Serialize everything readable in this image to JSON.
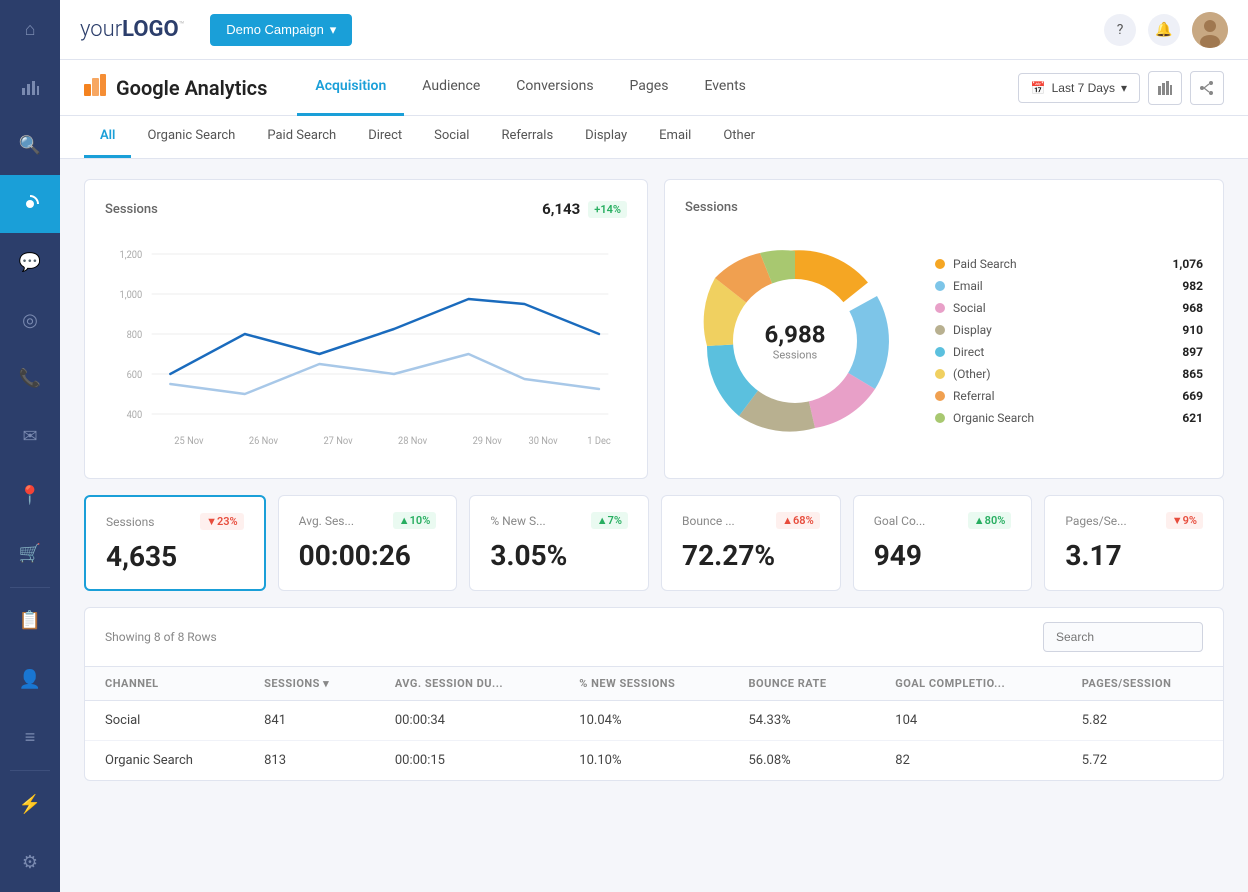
{
  "logo": {
    "text_your": "your",
    "text_logo": "LOGO",
    "trademark": "™"
  },
  "topbar": {
    "demo_btn": "Demo Campaign",
    "question_icon": "?",
    "bell_icon": "🔔"
  },
  "ga_header": {
    "title": "Google Analytics",
    "nav": [
      {
        "label": "Acquisition",
        "active": true
      },
      {
        "label": "Audience",
        "active": false
      },
      {
        "label": "Conversions",
        "active": false
      },
      {
        "label": "Pages",
        "active": false
      },
      {
        "label": "Events",
        "active": false
      }
    ],
    "date_btn": "Last 7 Days",
    "calendar_icon": "📅"
  },
  "sub_nav": {
    "items": [
      {
        "label": "All",
        "active": true
      },
      {
        "label": "Organic Search",
        "active": false
      },
      {
        "label": "Paid Search",
        "active": false
      },
      {
        "label": "Direct",
        "active": false
      },
      {
        "label": "Social",
        "active": false
      },
      {
        "label": "Referrals",
        "active": false
      },
      {
        "label": "Display",
        "active": false
      },
      {
        "label": "Email",
        "active": false
      },
      {
        "label": "Other",
        "active": false
      }
    ]
  },
  "sessions_chart": {
    "title": "Sessions",
    "value": "6,143",
    "badge": "+14%",
    "badge_type": "up",
    "x_labels": [
      "25 Nov",
      "26 Nov",
      "27 Nov",
      "28 Nov",
      "29 Nov",
      "30 Nov",
      "1 Dec"
    ],
    "y_labels": [
      "1,200",
      "1,000",
      "800",
      "600",
      "400"
    ]
  },
  "donut_chart": {
    "title": "Sessions",
    "center_value": "6,988",
    "center_label": "Sessions",
    "legend": [
      {
        "label": "Paid Search",
        "value": "1,076",
        "color": "#f5a623"
      },
      {
        "label": "Email",
        "value": "982",
        "color": "#7dc5e8"
      },
      {
        "label": "Social",
        "value": "968",
        "color": "#e8a0c8"
      },
      {
        "label": "Display",
        "value": "910",
        "color": "#b8b090"
      },
      {
        "label": "Direct",
        "value": "897",
        "color": "#5bc0de"
      },
      {
        "label": "(Other)",
        "value": "865",
        "color": "#f0d060"
      },
      {
        "label": "Referral",
        "value": "669",
        "color": "#f0a050"
      },
      {
        "label": "Organic Search",
        "value": "621",
        "color": "#a8c870"
      }
    ]
  },
  "metric_cards": [
    {
      "name": "Sessions",
      "value": "4,635",
      "badge": "▼23%",
      "badge_type": "down",
      "selected": true
    },
    {
      "name": "Avg. Ses...",
      "value": "00:00:26",
      "badge": "▲10%",
      "badge_type": "up",
      "selected": false
    },
    {
      "name": "% New S...",
      "value": "3.05%",
      "badge": "▲7%",
      "badge_type": "up",
      "selected": false
    },
    {
      "name": "Bounce ...",
      "value": "72.27%",
      "badge": "▲68%",
      "badge_type": "down",
      "selected": false
    },
    {
      "name": "Goal Co...",
      "value": "949",
      "badge": "▲80%",
      "badge_type": "up",
      "selected": false
    },
    {
      "name": "Pages/Se...",
      "value": "3.17",
      "badge": "▼9%",
      "badge_type": "down",
      "selected": false
    }
  ],
  "table": {
    "info": "Showing 8 of 8 Rows",
    "search_placeholder": "Search",
    "columns": [
      "CHANNEL",
      "SESSIONS",
      "AVG. SESSION DU...",
      "% NEW SESSIONS",
      "BOUNCE RATE",
      "GOAL COMPLETIO...",
      "PAGES/SESSION"
    ],
    "rows": [
      {
        "channel": "Social",
        "sessions": "841",
        "avg_session": "00:00:34",
        "pct_new": "10.04%",
        "bounce": "54.33%",
        "goal": "104",
        "pages": "5.82"
      },
      {
        "channel": "Organic Search",
        "sessions": "813",
        "avg_session": "00:00:15",
        "pct_new": "10.10%",
        "bounce": "56.08%",
        "goal": "82",
        "pages": "5.72"
      }
    ]
  },
  "sidebar": {
    "icons": [
      {
        "name": "home-icon",
        "symbol": "⌂",
        "active": false
      },
      {
        "name": "analytics-icon",
        "symbol": "📊",
        "active": false
      },
      {
        "name": "search-icon",
        "symbol": "🔍",
        "active": false
      },
      {
        "name": "dashboard-icon",
        "symbol": "◉",
        "active": true
      },
      {
        "name": "chat-icon",
        "symbol": "💬",
        "active": false
      },
      {
        "name": "target-icon",
        "symbol": "◎",
        "active": false
      },
      {
        "name": "phone-icon",
        "symbol": "📞",
        "active": false
      },
      {
        "name": "email-icon",
        "symbol": "✉",
        "active": false
      },
      {
        "name": "location-icon",
        "symbol": "📍",
        "active": false
      },
      {
        "name": "cart-icon",
        "symbol": "🛒",
        "active": false
      },
      {
        "name": "report-icon",
        "symbol": "📋",
        "active": false
      },
      {
        "name": "user-icon",
        "symbol": "👤",
        "active": false
      },
      {
        "name": "list-icon",
        "symbol": "≡",
        "active": false
      },
      {
        "name": "plugin-icon",
        "symbol": "⚡",
        "active": false
      },
      {
        "name": "settings-icon",
        "symbol": "⚙",
        "active": false
      }
    ]
  }
}
